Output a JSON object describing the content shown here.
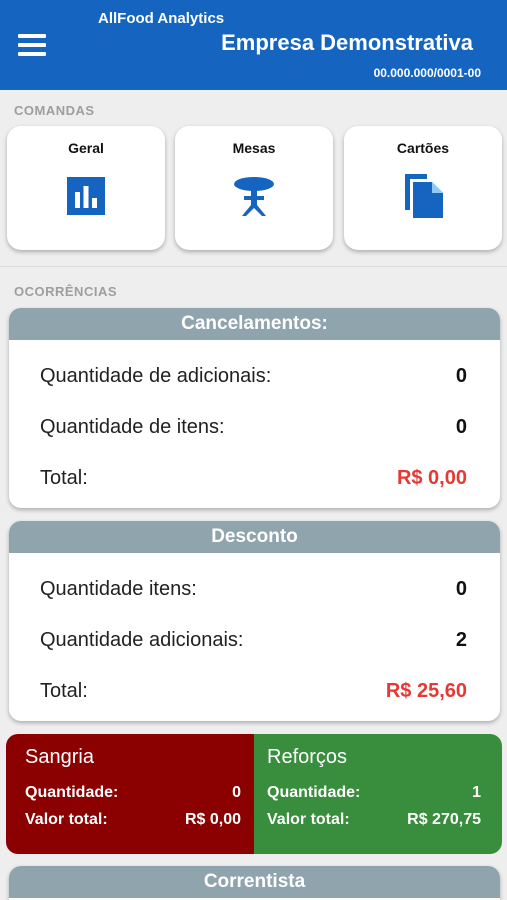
{
  "header": {
    "brand": "AllFood Analytics",
    "company": "Empresa Demonstrativa",
    "cnpj": "00.000.000/0001-00"
  },
  "comandas": {
    "section_label": "COMANDAS",
    "items": [
      {
        "label": "Geral",
        "icon": "bar-chart-icon"
      },
      {
        "label": "Mesas",
        "icon": "table-icon"
      },
      {
        "label": "Cartões",
        "icon": "copy-icon"
      }
    ]
  },
  "ocorrencias": {
    "section_label": "OCORRÊNCIAS",
    "cancelamentos": {
      "title": "Cancelamentos:",
      "rows": [
        {
          "label": "Quantidade de adicionais:",
          "value": "0"
        },
        {
          "label": "Quantidade de itens:",
          "value": "0"
        },
        {
          "label": "Total:",
          "value": "R$ 0,00"
        }
      ]
    },
    "desconto": {
      "title": "Desconto",
      "rows": [
        {
          "label": "Quantidade itens:",
          "value": "0"
        },
        {
          "label": "Quantidade adicionais:",
          "value": "2"
        },
        {
          "label": "Total:",
          "value": "R$ 25,60"
        }
      ]
    },
    "sangria": {
      "title": "Sangria",
      "qty_label": "Quantidade:",
      "qty": "0",
      "total_label": "Valor total:",
      "total": "R$ 0,00"
    },
    "reforcos": {
      "title": "Reforços",
      "qty_label": "Quantidade:",
      "qty": "1",
      "total_label": "Valor total:",
      "total": "R$ 270,75"
    },
    "correntista": {
      "title": "Correntista"
    }
  },
  "colors": {
    "appbar": "#1565c0",
    "icon_blue": "#1565c0",
    "card_header": "#90a4ae",
    "total_red": "#e53935",
    "sangria": "#8b0000",
    "reforcos": "#388e3c"
  }
}
